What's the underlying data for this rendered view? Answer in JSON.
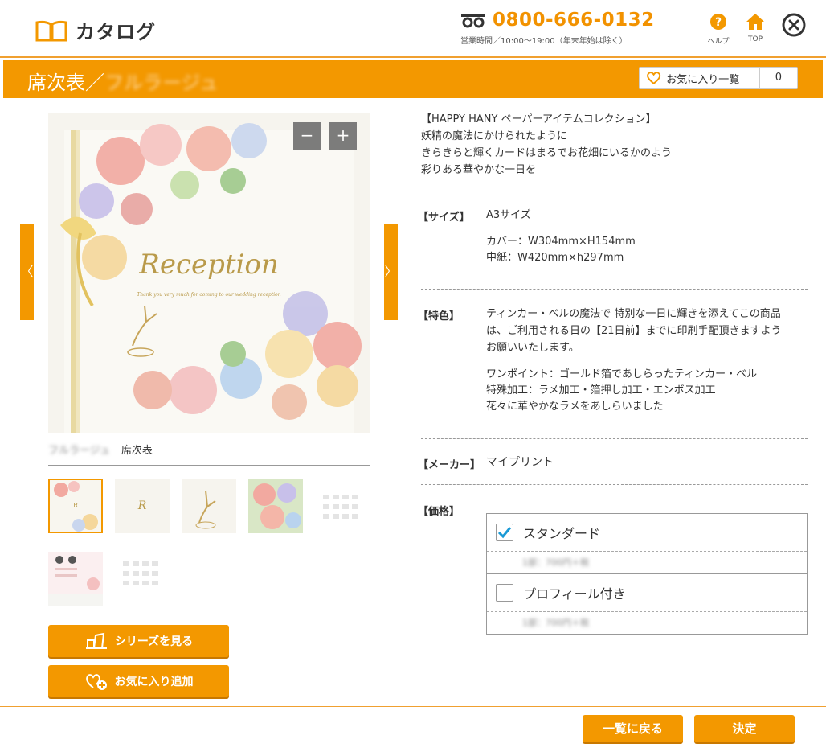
{
  "header": {
    "app_title": "カタログ",
    "phone": "0800-666-0132",
    "hours": "営業時間／10:00〜19:00（年末年始は除く）",
    "help_label": "ヘルプ",
    "top_label": "TOP",
    "accent_color": "#f39800"
  },
  "titlebar": {
    "title": "席次表／",
    "title_blurred": "フルラージュ",
    "favorites_label": "お気に入り一覧",
    "favorites_count": "0"
  },
  "product": {
    "caption_series": "フルラージュ",
    "caption_name": "席次表",
    "image_text": "Reception",
    "image_subtext": "Thank you very much for coming to our wedding reception",
    "zoom_out": "−",
    "zoom_in": "+",
    "prev_arrow": "〈",
    "next_arrow": "〉"
  },
  "buttons": {
    "series": "シリーズを見る",
    "add_favorite": "お気に入り追加",
    "back": "一覧に戻る",
    "decide": "決定"
  },
  "details": {
    "intro": [
      "【HAPPY HANY ペーパーアイテムコレクション】",
      "妖精の魔法にかけられたように",
      "きらきらと輝くカードはまるでお花畑にいるかのよう",
      "彩りある華やかな一日を"
    ],
    "size_label": "【サイズ】",
    "size_value": "A3サイズ",
    "size_cover": "カバー：W304mm×H154mm",
    "size_inner": "中紙：W420mm×h297mm",
    "feature_label": "【特色】",
    "feature_lines": [
      "ティンカー・ベルの魔法で 特別な一日に輝きを添えてこの商品",
      "は、ご利用される日の【21日前】までに印刷手配頂きますよう",
      "お願いいたします。"
    ],
    "feature_points": [
      "ワンポイント：ゴールド箔であしらったティンカー・ベル",
      "特殊加工：ラメ加工・箔押し加工・エンボス加工",
      "花々に華やかなラメをあしらいました"
    ],
    "maker_label": "【メーカー】",
    "maker_value": "マイプリント",
    "price_label": "【価格】",
    "options": [
      {
        "name": "スタンダード",
        "checked": true,
        "price": "1部：700円＋税"
      },
      {
        "name": "プロフィール付き",
        "checked": false,
        "price": "1部：700円＋税"
      }
    ]
  }
}
